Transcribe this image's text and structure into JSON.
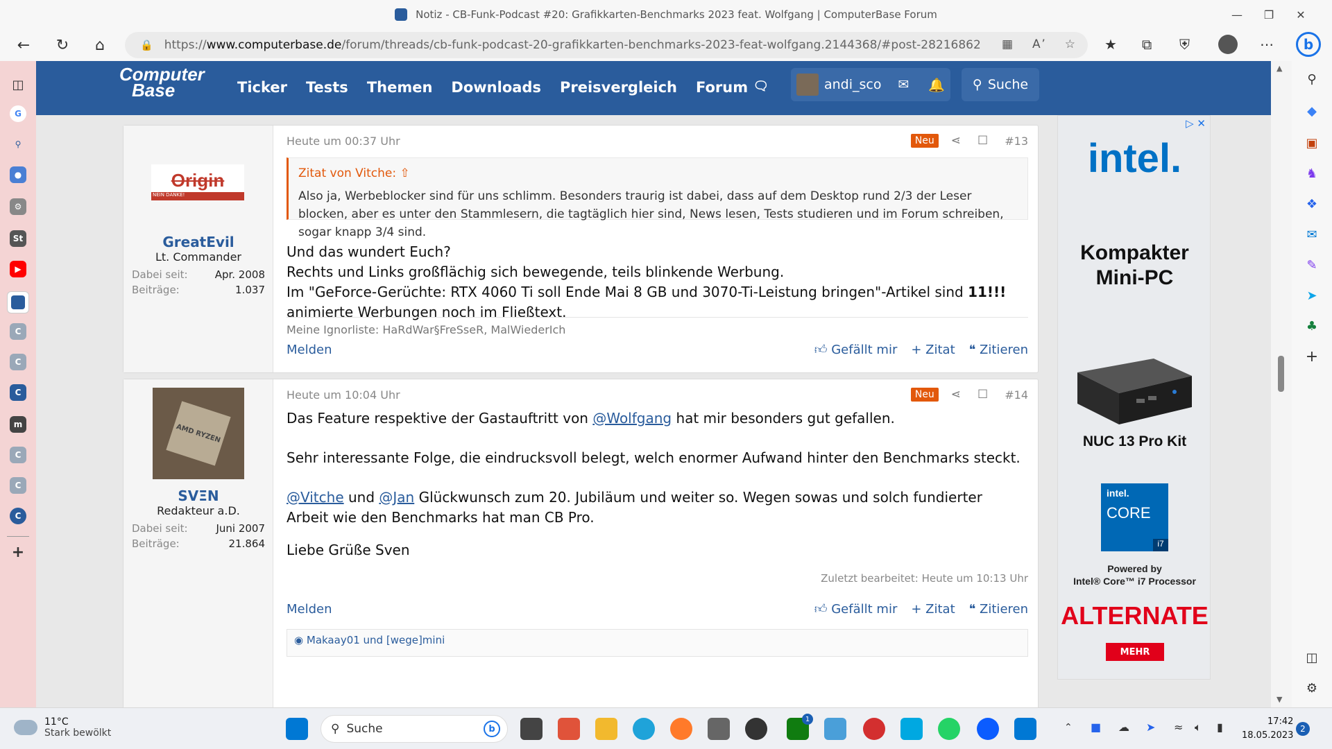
{
  "window": {
    "title": "Notiz - CB-Funk-Podcast #20: Grafikkarten-Benchmarks 2023 feat. Wolfgang | ComputerBase Forum"
  },
  "browser": {
    "url_prefix": "https://",
    "url_host": "www.computerbase.de",
    "url_path": "/forum/threads/cb-funk-podcast-20-grafikkarten-benchmarks-2023-feat-wolfgang.2144368/#post-28216862"
  },
  "site": {
    "logo_line1": "Computer",
    "logo_line2": "Base",
    "menu": [
      "Ticker",
      "Tests",
      "Themen",
      "Downloads",
      "Preisvergleich",
      "Forum"
    ],
    "username": "andi_sco",
    "search_label": "Suche"
  },
  "posts": [
    {
      "date": "Heute um 00:37 Uhr",
      "badge": "Neu",
      "number": "#13",
      "user": {
        "name": "GreatEvil",
        "title": "Lt. Commander",
        "joined_label": "Dabei seit:",
        "joined": "Apr. 2008",
        "posts_label": "Beiträge:",
        "posts": "1.037",
        "avatar_text": "Origin",
        "avatar_sub": "NEIN DANKE!"
      },
      "quote": {
        "header": "Zitat von Vitche:",
        "text": "Also ja, Werbeblocker sind für uns schlimm. Besonders traurig ist dabei, dass auf dem Desktop rund 2/3 der Leser blocken, aber es unter den Stammlesern, die tagtäglich hier sind, News lesen, Tests studieren und im Forum schreiben, sogar knapp 3/4 sind."
      },
      "lines": [
        "Und das wundert Euch?",
        "Rechts und Links großflächig sich bewegende, teils blinkende Werbung."
      ],
      "line3_pre": "Im \"GeForce-Gerüchte: RTX 4060 Ti soll Ende Mai 8 GB und 3070-Ti-Leistung bringen\"-Artikel sind ",
      "line3_bold": "11!!!",
      "line3_post": " animierte Werbungen noch im Fließtext.",
      "signature": "Meine Ignorliste: HaRdWar§FreSseR, MalWiederIch",
      "actions": {
        "report": "Melden",
        "like": "Gefällt mir",
        "quote": "+ Zitat",
        "reply": "Zitieren"
      }
    },
    {
      "date": "Heute um 10:04 Uhr",
      "badge": "Neu",
      "number": "#14",
      "user": {
        "name": "SVΞN",
        "title": "Redakteur a.D.",
        "joined_label": "Dabei seit:",
        "joined": "Juni 2007",
        "posts_label": "Beiträge:",
        "posts": "21.864",
        "avatar_text": "AMD RYZEN"
      },
      "p1_pre": "Das Feature respektive der Gastauftritt von ",
      "p1_link": "@Wolfgang",
      "p1_post": " hat mir besonders gut gefallen.",
      "p2": "Sehr interessante Folge, die eindrucksvoll belegt, welch enormer Aufwand hinter den Benchmarks steckt.",
      "p3_link1": "@Vitche",
      "p3_mid": " und ",
      "p3_link2": "@Jan",
      "p3_post": " Glückwunsch zum 20. Jubiläum und weiter so. Wegen sowas und solch fundierter Arbeit wie den Benchmarks hat man CB Pro.",
      "p4": "Liebe Grüße Sven",
      "edited": "Zuletzt bearbeitet: Heute um 10:13 Uhr",
      "actions": {
        "report": "Melden",
        "like": "Gefällt mir",
        "quote": "+ Zitat",
        "reply": "Zitieren"
      },
      "reactions": "Makaay01 und [wege]mini"
    }
  ],
  "ad": {
    "brand": "intel.",
    "headline": "Kompakter Mini-PC",
    "product": "NUC 13 Pro Kit",
    "badge_brand": "intel.",
    "badge_core": "CORE",
    "badge_tier": "i7",
    "powered": "Powered by",
    "processor": "Intel® Core™ i7 Processor",
    "retailer": "ALTERNATE",
    "cta": "MEHR"
  },
  "taskbar": {
    "temp": "11°C",
    "weather": "Stark bewölkt",
    "search": "Suche",
    "time": "17:42",
    "date": "18.05.2023",
    "notifications": "2"
  }
}
